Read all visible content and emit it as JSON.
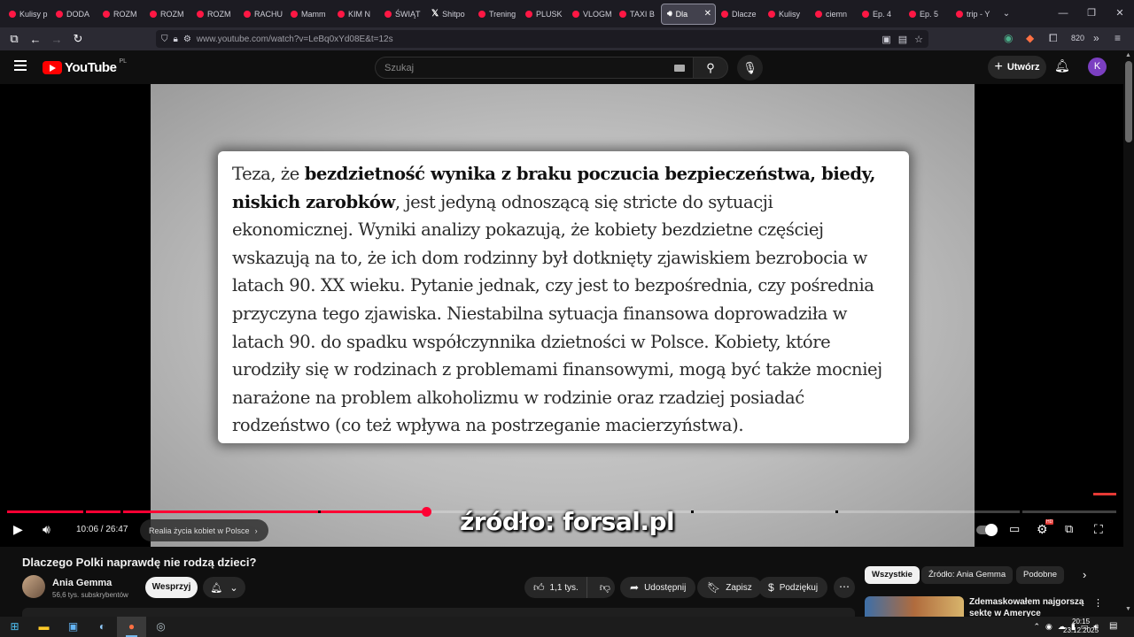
{
  "browser": {
    "tabs": [
      {
        "label": "Kulisy p",
        "icon": "youtube-icon"
      },
      {
        "label": "DODA",
        "icon": "youtube-icon"
      },
      {
        "label": "ROZM",
        "icon": "youtube-icon"
      },
      {
        "label": "ROZM",
        "icon": "youtube-icon"
      },
      {
        "label": "ROZM",
        "icon": "youtube-icon"
      },
      {
        "label": "RACHU",
        "icon": "youtube-icon"
      },
      {
        "label": "Mamm",
        "icon": "youtube-icon"
      },
      {
        "label": "KIM N",
        "icon": "youtube-icon"
      },
      {
        "label": "ŚWIĄT",
        "icon": "youtube-icon"
      },
      {
        "label": "Shitpo",
        "icon": "x-icon"
      },
      {
        "label": "Trening",
        "icon": "youtube-icon"
      },
      {
        "label": "PLUSK",
        "icon": "youtube-icon"
      },
      {
        "label": "VLOGM",
        "icon": "youtube-icon"
      },
      {
        "label": "TAXI B",
        "icon": "youtube-icon"
      },
      {
        "label": "Dla",
        "icon": "speaker-icon",
        "active": true
      },
      {
        "label": "Dlacze",
        "icon": "youtube-icon"
      },
      {
        "label": "Kulisy",
        "icon": "youtube-icon"
      },
      {
        "label": "ciemn",
        "icon": "youtube-icon"
      },
      {
        "label": "Ep. 4",
        "icon": "youtube-icon"
      },
      {
        "label": "Ep. 5",
        "icon": "youtube-icon"
      },
      {
        "label": "trip - Y",
        "icon": "youtube-icon"
      }
    ],
    "url": "www.youtube.com/watch?v=LeBq0xYd08E&t=12s",
    "extension_badge": "820"
  },
  "youtube": {
    "logo_text": "YouTube",
    "country_code": "PL",
    "search_placeholder": "Szukaj",
    "create_label": "Utwórz",
    "avatar_letter": "K"
  },
  "video": {
    "slide_text_bold_1": "bezdzietność wynika z braku poczucia bezpieczeństwa, biedy, niskich zarobków",
    "slide_text_prefix": "Teza, że ",
    "slide_text_rest": ", jest jedyną odnoszącą się stricte do sytuacji ekonomicznej. Wyniki analizy pokazują, że kobiety bezdzietne częściej wskazują na to, że ich dom rodzinny był dotknięty zjawiskiem bezrobocia w latach 90. XX wieku. Pytanie jednak, czy jest to bezpośrednia, czy pośrednia przyczyna tego zjawiska. Niestabilna sytuacja finansowa doprowadziła w latach 90. do spadku współczynnika dzietności w Polsce. Kobiety, które urodziły się w rodzinach z problemami finansowymi, mogą być także mocniej narażone na problem alkoholizmu w rodzinie oraz rzadziej posiadać rodzeństwo (co też wpływa na postrzeganie macierzyństwa).",
    "caption": "źródło: forsal.pl",
    "current_time": "10:06",
    "duration": "26:47",
    "time_display": "10:06 / 26:47",
    "progress_fraction": 0.3776,
    "chapter": "Realia życia kobiet w Polsce",
    "quality_badge": "HD"
  },
  "below": {
    "title": "Dlaczego Polki naprawdę nie rodzą dzieci?",
    "channel_name": "Ania Gemma",
    "subscribers": "56,6 tys. subskrybentów",
    "support_label": "Wesprzyj",
    "likes": "1,1 tys.",
    "share_label": "Udostępnij",
    "save_label": "Zapisz",
    "thanks_label": "Podziękuj",
    "chips": [
      "Wszystkie",
      "Źródło: Ania Gemma",
      "Podobne"
    ],
    "rec_title": "Zdemaskowałem najgorszą sektę w Ameryce"
  },
  "taskbar": {
    "time": "20:15",
    "date": "23.12.2025"
  }
}
